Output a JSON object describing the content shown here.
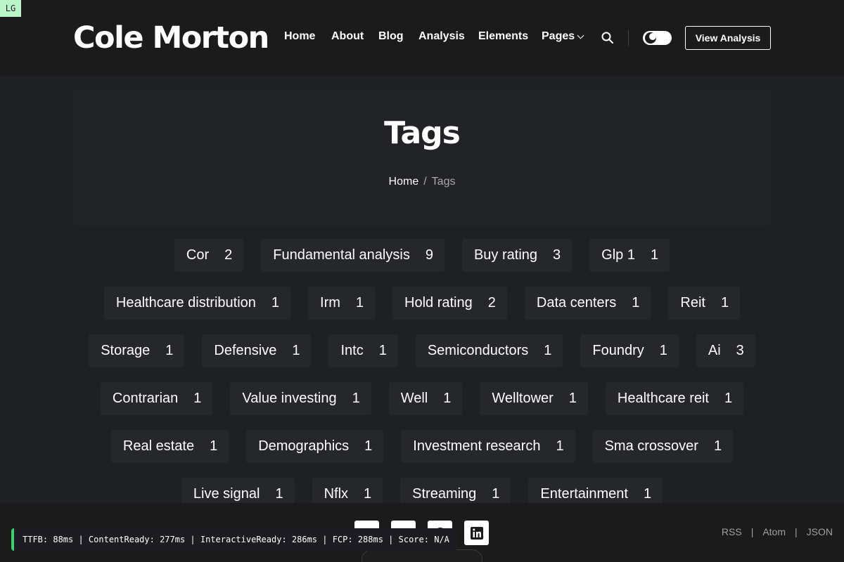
{
  "badge": "LG",
  "header": {
    "logo": "Cole Morton",
    "nav": [
      "Home",
      "About",
      "Blog",
      "Analysis",
      "Elements",
      "Pages"
    ],
    "cta": "View Analysis"
  },
  "hero": {
    "title": "Tags",
    "breadcrumb": {
      "home": "Home",
      "separator": "/",
      "current": "Tags"
    }
  },
  "tags": [
    {
      "name": "Cor",
      "count": "2"
    },
    {
      "name": "Fundamental analysis",
      "count": "9"
    },
    {
      "name": "Buy rating",
      "count": "3"
    },
    {
      "name": "Glp 1",
      "count": "1"
    },
    {
      "name": "Healthcare distribution",
      "count": "1"
    },
    {
      "name": "Irm",
      "count": "1"
    },
    {
      "name": "Hold rating",
      "count": "2"
    },
    {
      "name": "Data centers",
      "count": "1"
    },
    {
      "name": "Reit",
      "count": "1"
    },
    {
      "name": "Storage",
      "count": "1"
    },
    {
      "name": "Defensive",
      "count": "1"
    },
    {
      "name": "Intc",
      "count": "1"
    },
    {
      "name": "Semiconductors",
      "count": "1"
    },
    {
      "name": "Foundry",
      "count": "1"
    },
    {
      "name": "Ai",
      "count": "3"
    },
    {
      "name": "Contrarian",
      "count": "1"
    },
    {
      "name": "Value investing",
      "count": "1"
    },
    {
      "name": "Well",
      "count": "1"
    },
    {
      "name": "Welltower",
      "count": "1"
    },
    {
      "name": "Healthcare reit",
      "count": "1"
    },
    {
      "name": "Real estate",
      "count": "1"
    },
    {
      "name": "Demographics",
      "count": "1"
    },
    {
      "name": "Investment research",
      "count": "1"
    },
    {
      "name": "Sma crossover",
      "count": "1"
    },
    {
      "name": "Live signal",
      "count": "1"
    },
    {
      "name": "Nflx",
      "count": "1"
    },
    {
      "name": "Streaming",
      "count": "1"
    },
    {
      "name": "Entertainment",
      "count": "1"
    }
  ],
  "footer": {
    "feeds": [
      "RSS",
      "Atom",
      "JSON"
    ],
    "separator": "|",
    "social_icons": [
      "menu-icon",
      "twitter-icon",
      "github-icon",
      "linkedin-icon"
    ]
  },
  "perf": "TTFB: 88ms | ContentReady: 277ms | InteractiveReady: 286ms | FCP: 288ms | Score: N/A",
  "colors": {
    "background": "#1f2024",
    "header": "#1b1b1b",
    "tag_bg": "#26272b",
    "perf_accent": "#36d66b"
  }
}
